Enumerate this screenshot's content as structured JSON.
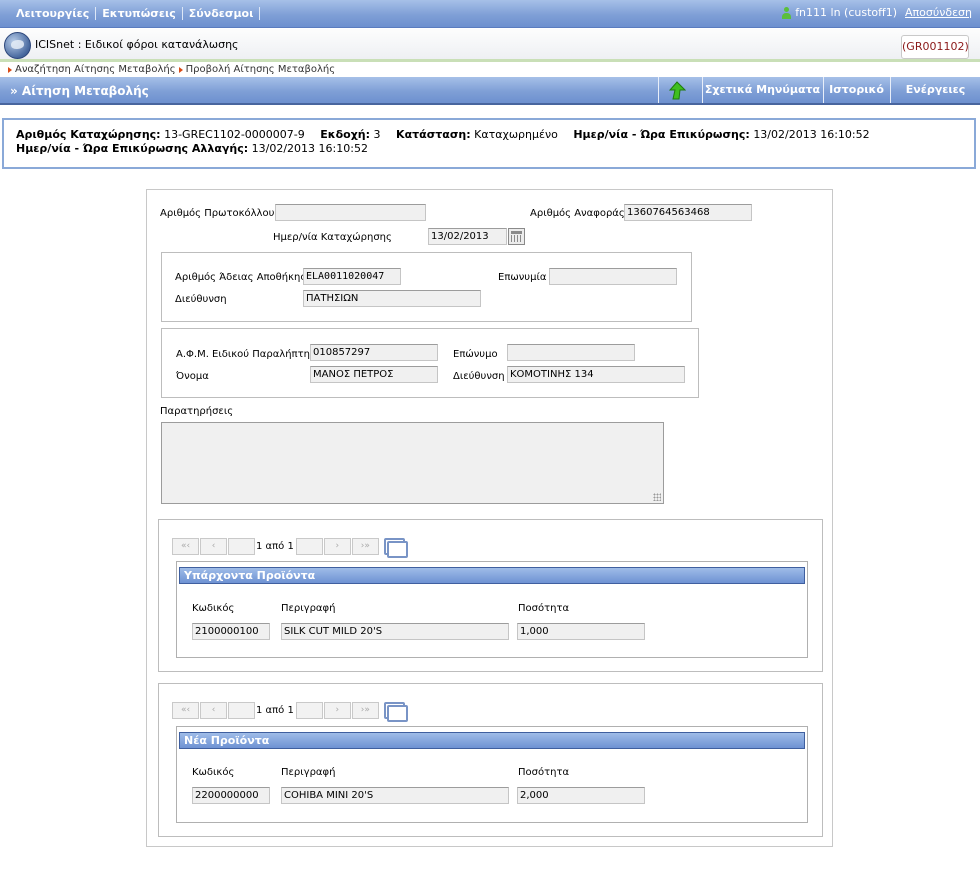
{
  "topmenu": {
    "items": [
      "Λειτουργίες",
      "Εκτυπώσεις",
      "Σύνδεσμοι"
    ],
    "user": "fn111 ln (custoff1)",
    "logout": "Αποσύνδεση"
  },
  "app": {
    "title": "ICISnet : Ειδικοί φόροι κατανάλωσης",
    "code": "(GR001102)"
  },
  "breadcrumb": [
    "Αναζήτηση Αίτησης Μεταβολής",
    "Προβολή Αίτησης Μεταβολής"
  ],
  "section": {
    "title": "» Αίτηση Μεταβολής",
    "buttons": [
      "Σχετικά Μηνύματα",
      "Ιστορικό",
      "Ενέργειες"
    ]
  },
  "info": {
    "reg_label": "Αριθμός Καταχώρησης:",
    "reg_value": "13-GREC1102-0000007-9",
    "version_label": "Εκδοχή:",
    "version_value": "3",
    "status_label": "Κατάσταση:",
    "status_value": "Καταχωρημένο",
    "confirm_label": "Ημερ/νία - Ώρα Επικύρωσης:",
    "confirm_value": "13/02/2013 16:10:52",
    "change_label": "Ημερ/νία - Ώρα Επικύρωσης Αλλαγής:",
    "change_value": "13/02/2013 16:10:52"
  },
  "form": {
    "protocol_label": "Αριθμός Πρωτοκόλλου",
    "protocol_value": "",
    "reference_label": "Αριθμός Αναφοράς",
    "reference_value": "1360764563468",
    "regdate_label": "Ημερ/νία Καταχώρησης",
    "regdate_value": "13/02/2013",
    "warehouse": {
      "license_label": "Αριθμός Άδειας Αποθήκης",
      "license_value": "ELA0011020047",
      "name_label": "Επωνυμία",
      "name_value": "",
      "address_label": "Διεύθυνση",
      "address_value": "ΠΑΤΗΣΙΩΝ"
    },
    "recipient": {
      "afm_label": "Α.Φ.Μ. Ειδικού Παραλήπτη",
      "afm_value": "010857297",
      "surname_label": "Επώνυμο",
      "surname_value": "",
      "firstname_label": "Όνομα",
      "firstname_value": "ΜΑΝΟΣ ΠΕΤΡΟΣ",
      "address_label": "Διεύθυνση",
      "address_value": "ΚΟΜΟΤΙΝΗΣ 134"
    },
    "remarks_label": "Παρατηρήσεις",
    "remarks_value": ""
  },
  "pager": {
    "first": "«‹",
    "prev": "‹",
    "next": "›",
    "last": "›»",
    "text": "1 από 1"
  },
  "existing": {
    "title": "Υπάρχοντα Προϊόντα",
    "code_label": "Κωδικός",
    "desc_label": "Περιγραφή",
    "qty_label": "Ποσότητα",
    "code": "2100000100",
    "desc": "SILK CUT MILD 20'S",
    "qty": "1,000"
  },
  "new": {
    "title": "Νέα Προϊόντα",
    "code_label": "Κωδικός",
    "desc_label": "Περιγραφή",
    "qty_label": "Ποσότητα",
    "code": "2200000000",
    "desc": "COHIBA MINI 20'S",
    "qty": "2,000"
  }
}
